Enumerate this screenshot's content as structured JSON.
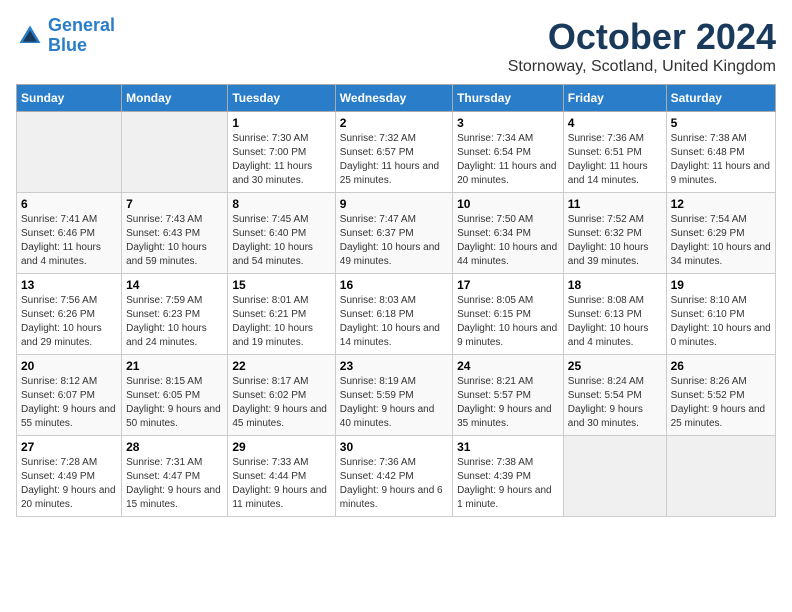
{
  "logo": {
    "line1": "General",
    "line2": "Blue"
  },
  "title": "October 2024",
  "subtitle": "Stornoway, Scotland, United Kingdom",
  "headers": [
    "Sunday",
    "Monday",
    "Tuesday",
    "Wednesday",
    "Thursday",
    "Friday",
    "Saturday"
  ],
  "weeks": [
    [
      {
        "day": "",
        "sunrise": "",
        "sunset": "",
        "daylight": ""
      },
      {
        "day": "",
        "sunrise": "",
        "sunset": "",
        "daylight": ""
      },
      {
        "day": "1",
        "sunrise": "Sunrise: 7:30 AM",
        "sunset": "Sunset: 7:00 PM",
        "daylight": "Daylight: 11 hours and 30 minutes."
      },
      {
        "day": "2",
        "sunrise": "Sunrise: 7:32 AM",
        "sunset": "Sunset: 6:57 PM",
        "daylight": "Daylight: 11 hours and 25 minutes."
      },
      {
        "day": "3",
        "sunrise": "Sunrise: 7:34 AM",
        "sunset": "Sunset: 6:54 PM",
        "daylight": "Daylight: 11 hours and 20 minutes."
      },
      {
        "day": "4",
        "sunrise": "Sunrise: 7:36 AM",
        "sunset": "Sunset: 6:51 PM",
        "daylight": "Daylight: 11 hours and 14 minutes."
      },
      {
        "day": "5",
        "sunrise": "Sunrise: 7:38 AM",
        "sunset": "Sunset: 6:48 PM",
        "daylight": "Daylight: 11 hours and 9 minutes."
      }
    ],
    [
      {
        "day": "6",
        "sunrise": "Sunrise: 7:41 AM",
        "sunset": "Sunset: 6:46 PM",
        "daylight": "Daylight: 11 hours and 4 minutes."
      },
      {
        "day": "7",
        "sunrise": "Sunrise: 7:43 AM",
        "sunset": "Sunset: 6:43 PM",
        "daylight": "Daylight: 10 hours and 59 minutes."
      },
      {
        "day": "8",
        "sunrise": "Sunrise: 7:45 AM",
        "sunset": "Sunset: 6:40 PM",
        "daylight": "Daylight: 10 hours and 54 minutes."
      },
      {
        "day": "9",
        "sunrise": "Sunrise: 7:47 AM",
        "sunset": "Sunset: 6:37 PM",
        "daylight": "Daylight: 10 hours and 49 minutes."
      },
      {
        "day": "10",
        "sunrise": "Sunrise: 7:50 AM",
        "sunset": "Sunset: 6:34 PM",
        "daylight": "Daylight: 10 hours and 44 minutes."
      },
      {
        "day": "11",
        "sunrise": "Sunrise: 7:52 AM",
        "sunset": "Sunset: 6:32 PM",
        "daylight": "Daylight: 10 hours and 39 minutes."
      },
      {
        "day": "12",
        "sunrise": "Sunrise: 7:54 AM",
        "sunset": "Sunset: 6:29 PM",
        "daylight": "Daylight: 10 hours and 34 minutes."
      }
    ],
    [
      {
        "day": "13",
        "sunrise": "Sunrise: 7:56 AM",
        "sunset": "Sunset: 6:26 PM",
        "daylight": "Daylight: 10 hours and 29 minutes."
      },
      {
        "day": "14",
        "sunrise": "Sunrise: 7:59 AM",
        "sunset": "Sunset: 6:23 PM",
        "daylight": "Daylight: 10 hours and 24 minutes."
      },
      {
        "day": "15",
        "sunrise": "Sunrise: 8:01 AM",
        "sunset": "Sunset: 6:21 PM",
        "daylight": "Daylight: 10 hours and 19 minutes."
      },
      {
        "day": "16",
        "sunrise": "Sunrise: 8:03 AM",
        "sunset": "Sunset: 6:18 PM",
        "daylight": "Daylight: 10 hours and 14 minutes."
      },
      {
        "day": "17",
        "sunrise": "Sunrise: 8:05 AM",
        "sunset": "Sunset: 6:15 PM",
        "daylight": "Daylight: 10 hours and 9 minutes."
      },
      {
        "day": "18",
        "sunrise": "Sunrise: 8:08 AM",
        "sunset": "Sunset: 6:13 PM",
        "daylight": "Daylight: 10 hours and 4 minutes."
      },
      {
        "day": "19",
        "sunrise": "Sunrise: 8:10 AM",
        "sunset": "Sunset: 6:10 PM",
        "daylight": "Daylight: 10 hours and 0 minutes."
      }
    ],
    [
      {
        "day": "20",
        "sunrise": "Sunrise: 8:12 AM",
        "sunset": "Sunset: 6:07 PM",
        "daylight": "Daylight: 9 hours and 55 minutes."
      },
      {
        "day": "21",
        "sunrise": "Sunrise: 8:15 AM",
        "sunset": "Sunset: 6:05 PM",
        "daylight": "Daylight: 9 hours and 50 minutes."
      },
      {
        "day": "22",
        "sunrise": "Sunrise: 8:17 AM",
        "sunset": "Sunset: 6:02 PM",
        "daylight": "Daylight: 9 hours and 45 minutes."
      },
      {
        "day": "23",
        "sunrise": "Sunrise: 8:19 AM",
        "sunset": "Sunset: 5:59 PM",
        "daylight": "Daylight: 9 hours and 40 minutes."
      },
      {
        "day": "24",
        "sunrise": "Sunrise: 8:21 AM",
        "sunset": "Sunset: 5:57 PM",
        "daylight": "Daylight: 9 hours and 35 minutes."
      },
      {
        "day": "25",
        "sunrise": "Sunrise: 8:24 AM",
        "sunset": "Sunset: 5:54 PM",
        "daylight": "Daylight: 9 hours and 30 minutes."
      },
      {
        "day": "26",
        "sunrise": "Sunrise: 8:26 AM",
        "sunset": "Sunset: 5:52 PM",
        "daylight": "Daylight: 9 hours and 25 minutes."
      }
    ],
    [
      {
        "day": "27",
        "sunrise": "Sunrise: 7:28 AM",
        "sunset": "Sunset: 4:49 PM",
        "daylight": "Daylight: 9 hours and 20 minutes."
      },
      {
        "day": "28",
        "sunrise": "Sunrise: 7:31 AM",
        "sunset": "Sunset: 4:47 PM",
        "daylight": "Daylight: 9 hours and 15 minutes."
      },
      {
        "day": "29",
        "sunrise": "Sunrise: 7:33 AM",
        "sunset": "Sunset: 4:44 PM",
        "daylight": "Daylight: 9 hours and 11 minutes."
      },
      {
        "day": "30",
        "sunrise": "Sunrise: 7:36 AM",
        "sunset": "Sunset: 4:42 PM",
        "daylight": "Daylight: 9 hours and 6 minutes."
      },
      {
        "day": "31",
        "sunrise": "Sunrise: 7:38 AM",
        "sunset": "Sunset: 4:39 PM",
        "daylight": "Daylight: 9 hours and 1 minute."
      },
      {
        "day": "",
        "sunrise": "",
        "sunset": "",
        "daylight": ""
      },
      {
        "day": "",
        "sunrise": "",
        "sunset": "",
        "daylight": ""
      }
    ]
  ]
}
